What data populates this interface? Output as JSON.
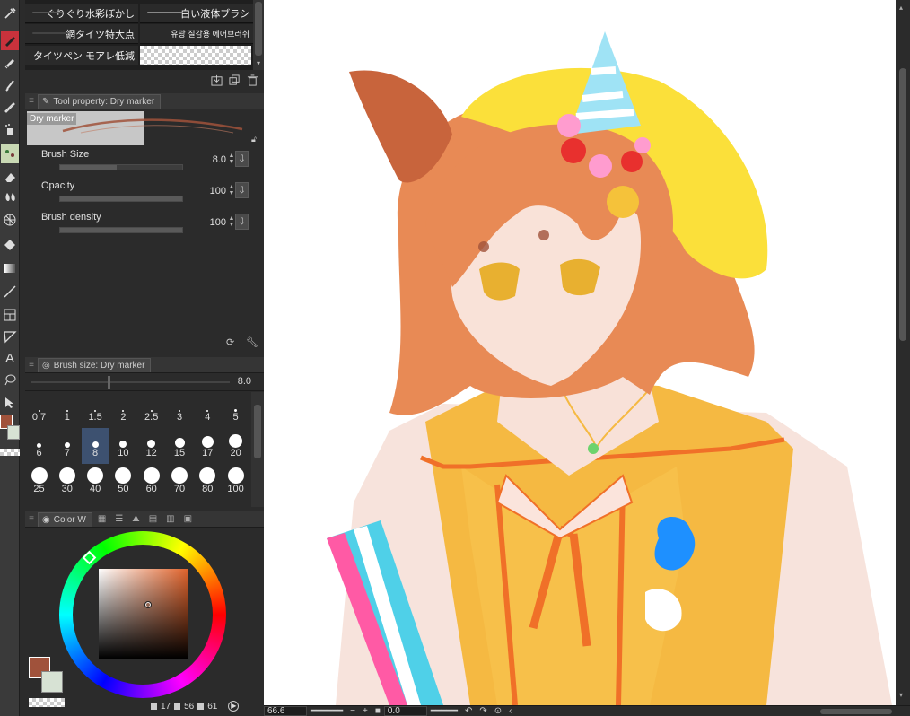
{
  "brush_list": {
    "items": [
      {
        "label": "ぐりぐり水彩ぼかし",
        "checker": false
      },
      {
        "label": "白い液体ブラシ",
        "checker": false
      },
      {
        "label": "網タイツ特大点",
        "checker": false
      },
      {
        "label": "유광 질감용 에어브러쉬",
        "checker": false
      },
      {
        "label": "タイツペン モアレ低減",
        "checker": false
      },
      {
        "label": "",
        "checker": true
      }
    ]
  },
  "tool_property": {
    "tab_label": "Tool property: Dry marker",
    "brush_name": "Dry marker",
    "rows": [
      {
        "label": "Brush Size",
        "value": "8.0",
        "fill_pct": 0.46
      },
      {
        "label": "Opacity",
        "value": "100",
        "fill_pct": 1.0
      },
      {
        "label": "Brush density",
        "value": "100",
        "fill_pct": 1.0
      }
    ]
  },
  "brush_size_panel": {
    "tab_label": "Brush size: Dry marker",
    "current_value": "8.0",
    "sizes": [
      "0.7",
      "1",
      "1.5",
      "2",
      "2.5",
      "3",
      "4",
      "5",
      "6",
      "7",
      "8",
      "10",
      "12",
      "15",
      "17",
      "20",
      "25",
      "30",
      "40",
      "50",
      "60",
      "70",
      "80",
      "100"
    ],
    "selected": "8"
  },
  "color_panel": {
    "tab_label": "Color W",
    "main_color": "#a0523b",
    "sub_color": "#d7e2d4",
    "status": {
      "a": "17",
      "b": "56",
      "c": "61"
    }
  },
  "statusbar": {
    "zoom": "66.6",
    "angle": "0.0"
  },
  "colors": {
    "accent_red": "#c8323c",
    "panel_bg": "#2b2b2b",
    "canvas_bg": "#ffffff"
  },
  "icons": [
    "eyedropper-icon",
    "pen-icon",
    "marker-icon",
    "ink-pen-icon",
    "pencil-icon",
    "airbrush-icon",
    "decoration-icon",
    "eraser-icon",
    "blend-icon",
    "grid-icon",
    "fill-icon",
    "gradient-icon",
    "line-icon",
    "frame-icon",
    "ruler-icon",
    "text-icon",
    "lasso-icon",
    "select-icon"
  ]
}
